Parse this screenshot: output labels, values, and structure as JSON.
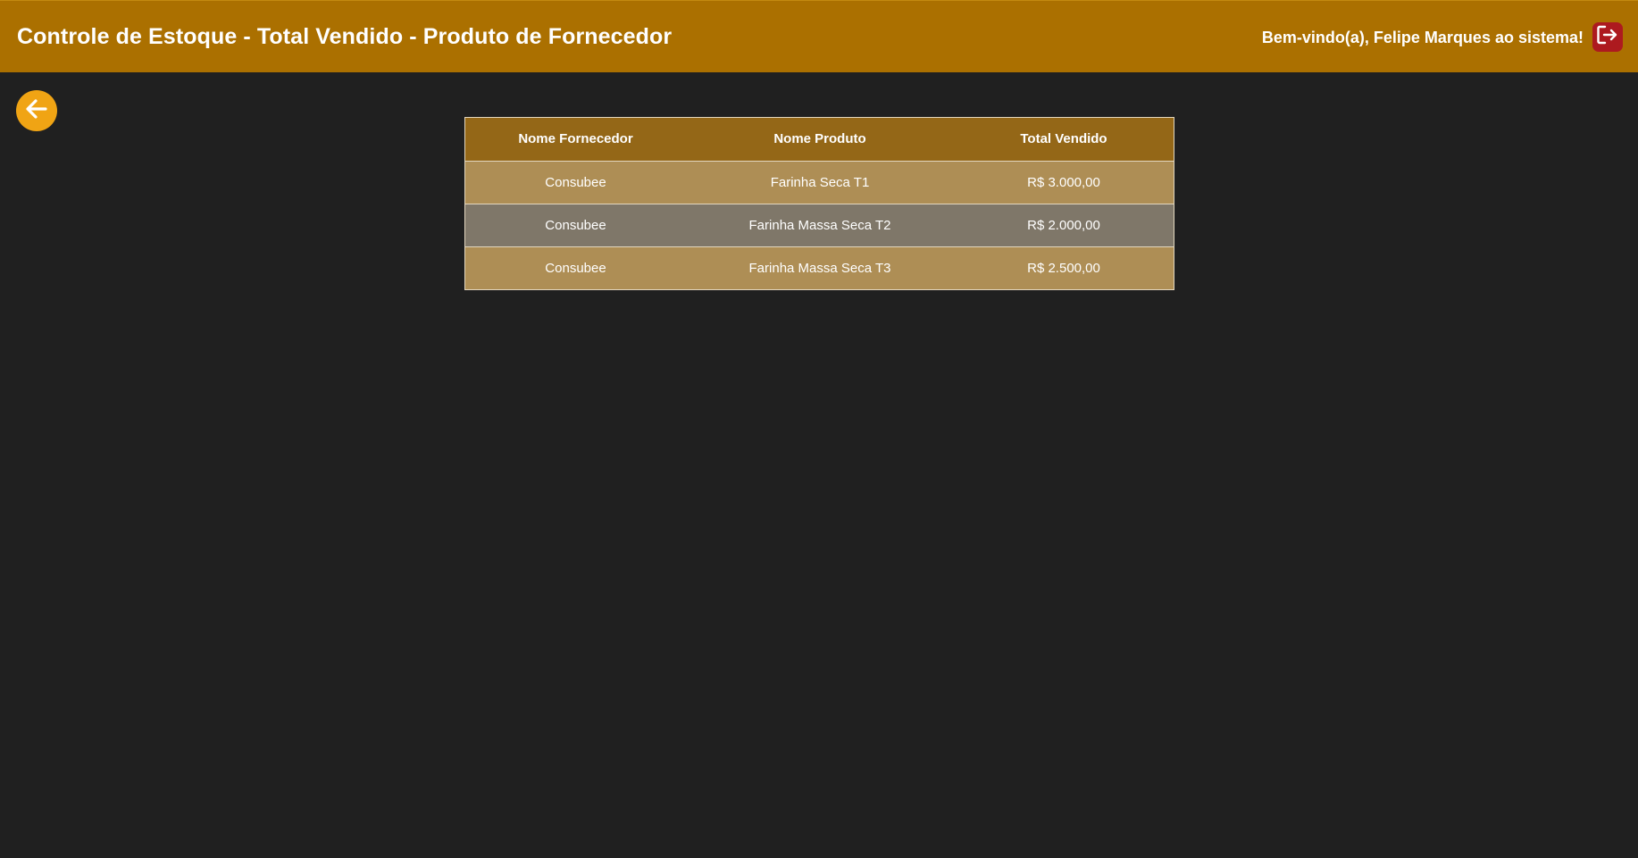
{
  "header": {
    "title": "Controle de Estoque - Total Vendido - Produto de Fornecedor",
    "welcome": "Bem-vindo(a), Felipe Marques ao sistema!",
    "logout_icon": "logout-icon",
    "background_color": "#ab7000"
  },
  "navigation": {
    "back_icon": "arrow-left-icon",
    "back_color": "#f0a414"
  },
  "table": {
    "columns": [
      "Nome Fornecedor",
      "Nome Produto",
      "Total Vendido"
    ],
    "rows": [
      [
        "Consubee",
        "Farinha Seca T1",
        "R$ 3.000,00"
      ],
      [
        "Consubee",
        "Farinha Massa Seca T2",
        "R$ 2.000,00"
      ],
      [
        "Consubee",
        "Farinha Massa Seca T3",
        "R$ 2.500,00"
      ]
    ],
    "header_color": "#946717",
    "row_colors": [
      "#ae8e55",
      "#7f7769",
      "#ae8e55"
    ]
  }
}
